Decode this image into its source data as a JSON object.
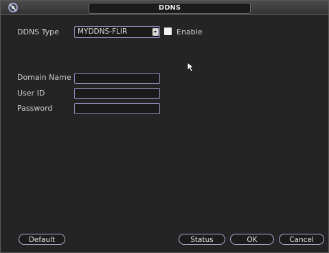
{
  "window": {
    "title": "DDNS"
  },
  "form": {
    "ddns_type_label": "DDNS Type",
    "ddns_type_value": "MYDDNS-FLIR",
    "enable_label": "Enable",
    "enable_checked": false,
    "domain_name_label": "Domain Name",
    "domain_name_value": "",
    "user_id_label": "User ID",
    "user_id_value": "",
    "password_label": "Password",
    "password_value": ""
  },
  "buttons": {
    "default": "Default",
    "status": "Status",
    "ok": "OK",
    "cancel": "Cancel"
  },
  "icons": {
    "logo": "app-logo-icon",
    "dropdown": "chevron-down-icon",
    "cursor": "mouse-pointer-icon"
  },
  "colors": {
    "field_border": "#8e88b4",
    "button_border": "#b7b1d8",
    "background": "#242424"
  }
}
